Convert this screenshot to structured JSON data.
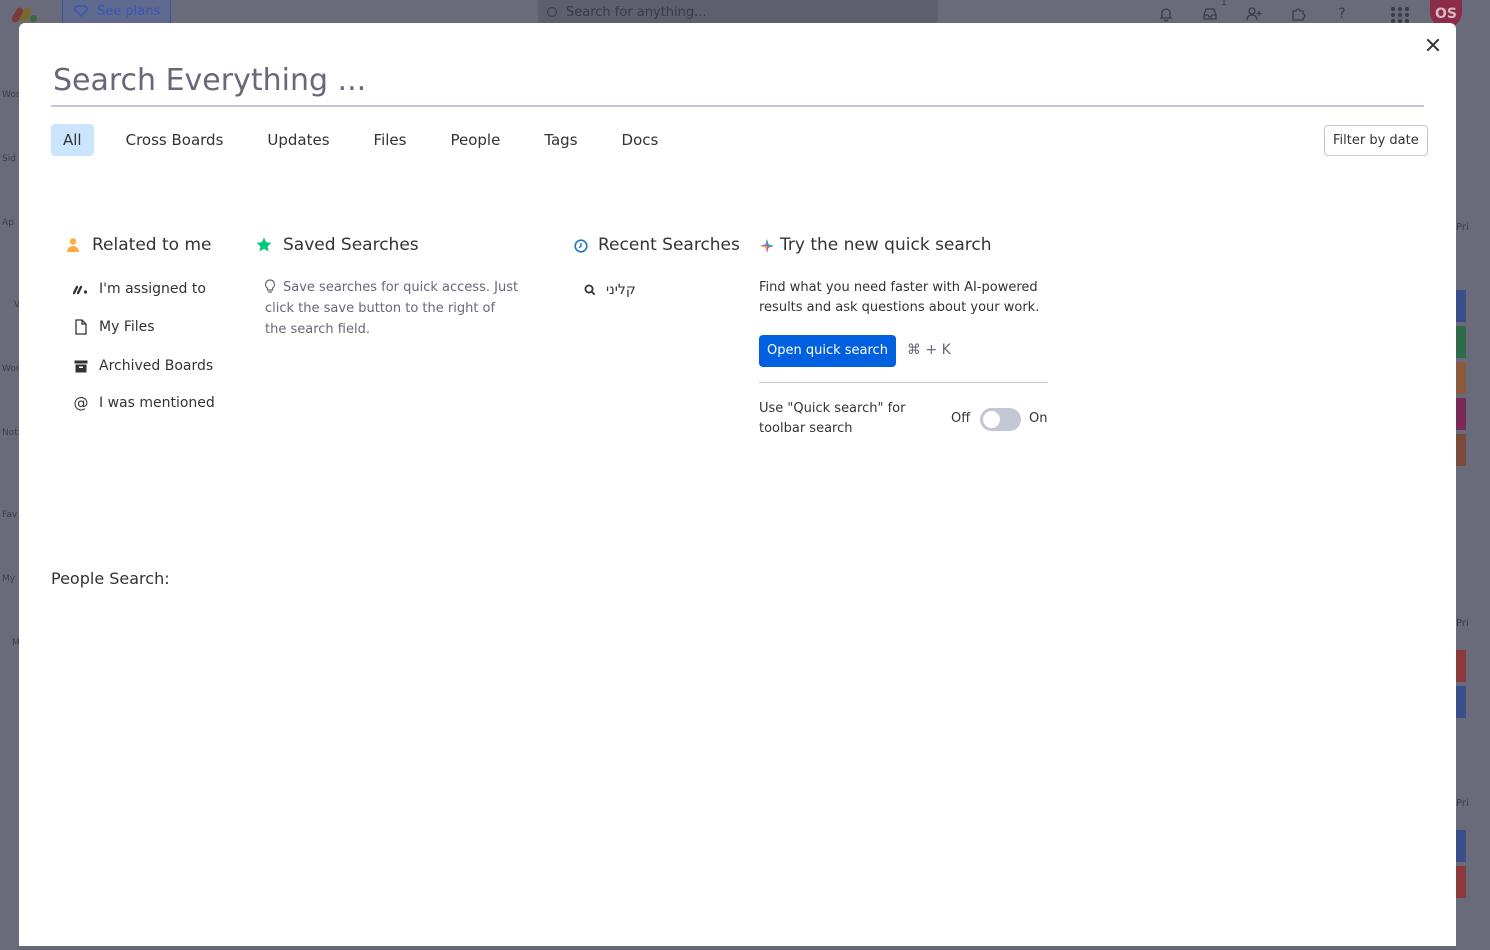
{
  "background": {
    "see_plans": "See plans",
    "search_placeholder": "Search for anything...",
    "inbox_count": "1",
    "avatar_initials": "OS",
    "sidebar_labels": [
      "Wor",
      "Sid",
      "Ap",
      "V",
      "Wor",
      "Not",
      "Fav",
      "My",
      "M"
    ],
    "right_labels": [
      "Pri",
      "Pri",
      "Pri"
    ]
  },
  "modal": {
    "search": {
      "placeholder": "Search Everything ..."
    },
    "tabs": [
      "All",
      "Cross Boards",
      "Updates",
      "Files",
      "People",
      "Tags",
      "Docs"
    ],
    "active_tab": "All",
    "filter_button": "Filter by date",
    "related": {
      "title": "Related to me",
      "items": [
        "I'm assigned to",
        "My Files",
        "Archived Boards",
        "I was mentioned"
      ]
    },
    "saved": {
      "title": "Saved Searches",
      "hint": "Save searches for quick access. Just click the save button to the right of the search field."
    },
    "recent": {
      "title": "Recent Searches",
      "items": [
        "קליני"
      ]
    },
    "quick": {
      "title": "Try the new quick search",
      "description": "Find what you need faster with AI-powered results and ask questions about your work.",
      "button": "Open quick search",
      "shortcut": "⌘ + K",
      "toggle_label": "Use \"Quick search\" for toolbar search",
      "off": "Off",
      "on": "On",
      "toggle_state": "off"
    },
    "people_search_title": "People Search:"
  },
  "colors": {
    "accent": "#0060df",
    "active_tab": "#cce5ff",
    "person_icon": "#fdab3d",
    "star_icon": "#00c875",
    "clock_icon": "#1f76c2"
  }
}
